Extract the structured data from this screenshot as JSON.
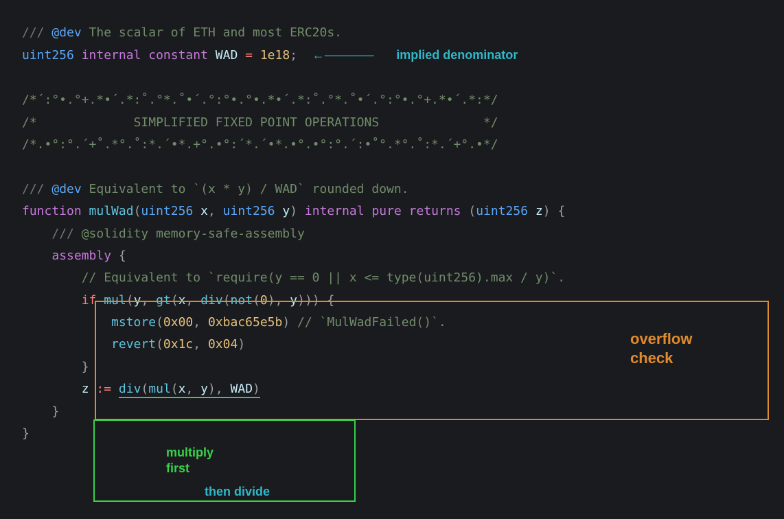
{
  "line1": {
    "slashes": "///",
    "tag": "@dev",
    "text": " The scalar of ETH and most ERC20s."
  },
  "line2": {
    "type": "uint256",
    "vis": "internal",
    "const": "constant",
    "name": "WAD",
    "eq": " = ",
    "value": "1e18",
    "semi": ";"
  },
  "arrow_implied": "←————",
  "ann_implied": "implied denominator",
  "banner_top": "/*´:°•.°+.*•´.*:˚.°*.˚•´.°:°•.°•.*•´.*:˚.°*.˚•´.°:°•.°+.*•´.*:*/",
  "banner_mid_open": "/*",
  "banner_mid_text": "             SIMPLIFIED FIXED POINT OPERATIONS              ",
  "banner_mid_close": "*/",
  "banner_bot": "/*.•°:°.´+˚.*°.˚:*.´•*.+°.•°:´*.´•*.•°.•°:°.´:•˚°.*°.˚:*.´+°.•*/",
  "line7": {
    "slashes": "///",
    "tag": "@dev",
    "text": " Equivalent to `(x * y) / WAD` rounded down."
  },
  "fn": {
    "kw": "function",
    "name": "mulWad",
    "lp": "(",
    "t1": "uint256",
    "p1": "x",
    "c1": ", ",
    "t2": "uint256",
    "p2": "y",
    "rp": ") ",
    "vis": "internal",
    "pure": "pure",
    "ret": "returns",
    "lp2": " (",
    "t3": "uint256",
    "p3": "z",
    "rp2": ") ",
    "brace": "{"
  },
  "line9": {
    "slashes": "///",
    "text": " @solidity memory-safe-assembly"
  },
  "line10": {
    "kw": "assembly",
    "brace": " {"
  },
  "line11": {
    "text": "// Equivalent to `require(y == 0 || x <= type(uint256).max / y)`."
  },
  "line12": {
    "ifkw": "if",
    "s1": " ",
    "mul": "mul",
    "lp": "(",
    "y1": "y",
    "c1": ", ",
    "gt": "gt",
    "lp2": "(",
    "x": "x",
    "c2": ", ",
    "div": "div",
    "lp3": "(",
    "not": "not",
    "lp4": "(",
    "zero": "0",
    "rp4": ")",
    "c3": ", ",
    "y2": "y",
    "rp3": ")",
    "rp2": ")",
    "rp1": ")",
    "s2": " ",
    "brace": "{"
  },
  "line13": {
    "mstore": "mstore",
    "lp": "(",
    "a1": "0x00",
    "c": ", ",
    "a2": "0xbac65e5b",
    "rp": ")",
    "cmt": " // `MulWadFailed()`."
  },
  "line14": {
    "rev": "revert",
    "lp": "(",
    "a1": "0x1c",
    "c": ", ",
    "a2": "0x04",
    "rp": ")"
  },
  "line15": {
    "brace": "}"
  },
  "line16": {
    "z": "z",
    "assign": " := ",
    "div": "div",
    "lp": "(",
    "mul": "mul",
    "lp2": "(",
    "x": "x",
    "c1": ", ",
    "y": "y",
    "rp2": ")",
    "c2": ", ",
    "wad": "WAD",
    "rp": ")"
  },
  "line17": {
    "brace": "}"
  },
  "line18": {
    "brace": "}"
  },
  "ann_overflow1": "overflow",
  "ann_overflow2": "check",
  "ann_multiply1": "multiply",
  "ann_multiply2": "first",
  "ann_divide": "then divide"
}
